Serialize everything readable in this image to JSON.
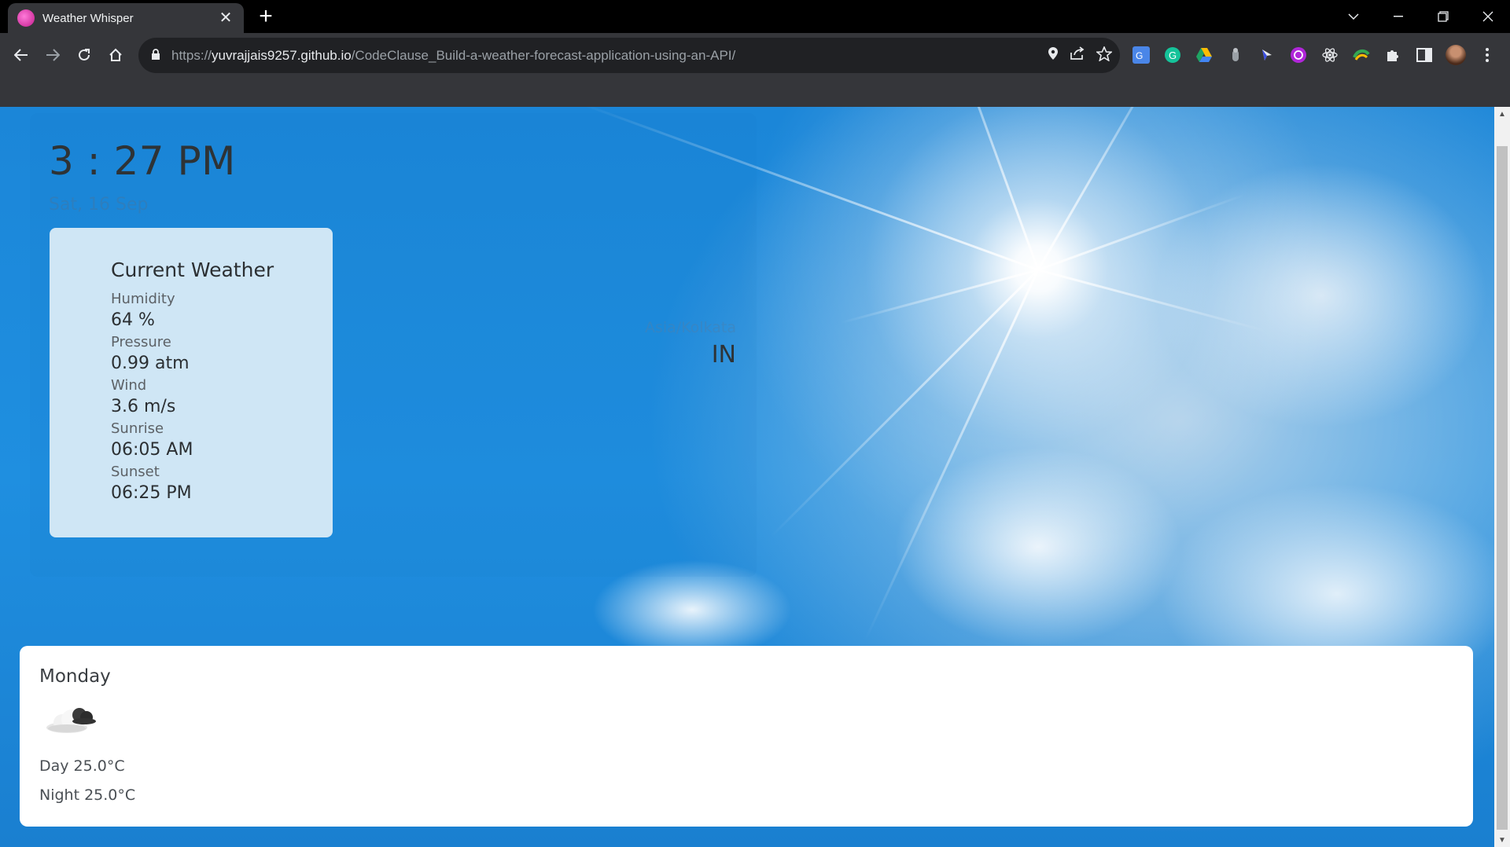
{
  "browser": {
    "tab_title": "Weather Whisper",
    "url_scheme": "https://",
    "url_host": "yuvrajjais9257.github.io",
    "url_path": "/CodeClause_Build-a-weather-forecast-application-using-an-API/"
  },
  "clock": {
    "time": "3 : 27 PM",
    "date": "Sat, 16 Sep"
  },
  "current_weather": {
    "title": "Current Weather",
    "items": [
      {
        "label": "Humidity",
        "value": "64 %"
      },
      {
        "label": "Pressure",
        "value": "0.99 atm"
      },
      {
        "label": "Wind",
        "value": "3.6 m/s"
      },
      {
        "label": "Sunrise",
        "value": "06:05 AM"
      },
      {
        "label": "Sunset",
        "value": "06:25 PM"
      }
    ]
  },
  "location": {
    "timezone": "Asia/Kolkata",
    "country": "IN"
  },
  "forecast": {
    "day": "Monday",
    "icon": "cloud-icon",
    "day_temp": "Day 25.0°C",
    "night_temp": "Night 25.0°C"
  }
}
